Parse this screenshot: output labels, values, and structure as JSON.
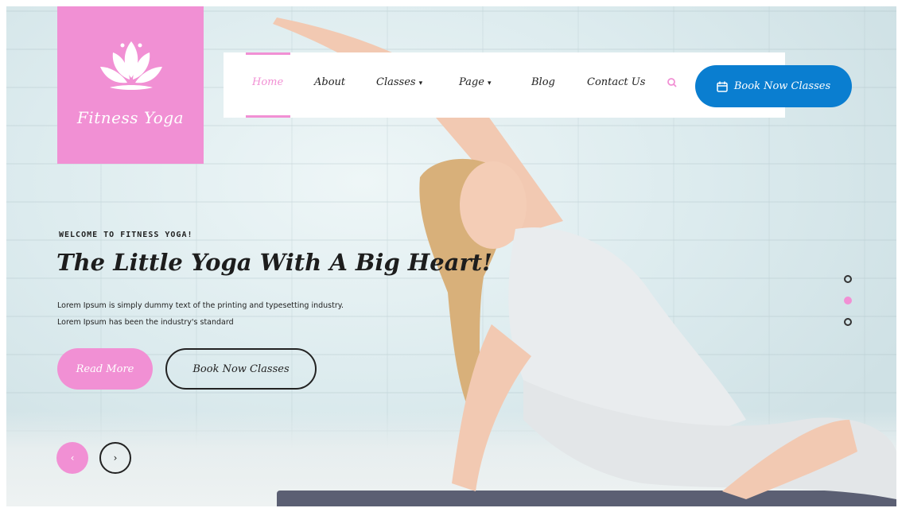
{
  "logo": {
    "brand": "Fitness Yoga",
    "icon": "lotus-icon"
  },
  "nav": {
    "items": [
      {
        "label": "Home",
        "active": true
      },
      {
        "label": "About"
      },
      {
        "label": "Classes",
        "dropdown": true
      },
      {
        "label": "Page",
        "dropdown": true
      },
      {
        "label": "Blog"
      },
      {
        "label": "Contact Us"
      }
    ],
    "search_icon": "search-icon",
    "book_label": "Book Now Classes",
    "book_icon": "calendar-icon"
  },
  "hero": {
    "eyebrow": "WELCOME TO FITNESS YOGA!",
    "headline": "The Little Yoga With A Big Heart!",
    "description_line1": "Lorem Ipsum is simply dummy text of the printing and typesetting industry.",
    "description_line2": "Lorem Ipsum has been the industry's standard",
    "read_more": "Read More",
    "book_now": "Book Now Classes",
    "prev_arrow": "‹",
    "next_arrow": "›"
  },
  "slider": {
    "dots": 3,
    "active_dot": 2
  },
  "colors": {
    "accent_pink": "#f190d4",
    "accent_blue": "#0a7ed0"
  }
}
